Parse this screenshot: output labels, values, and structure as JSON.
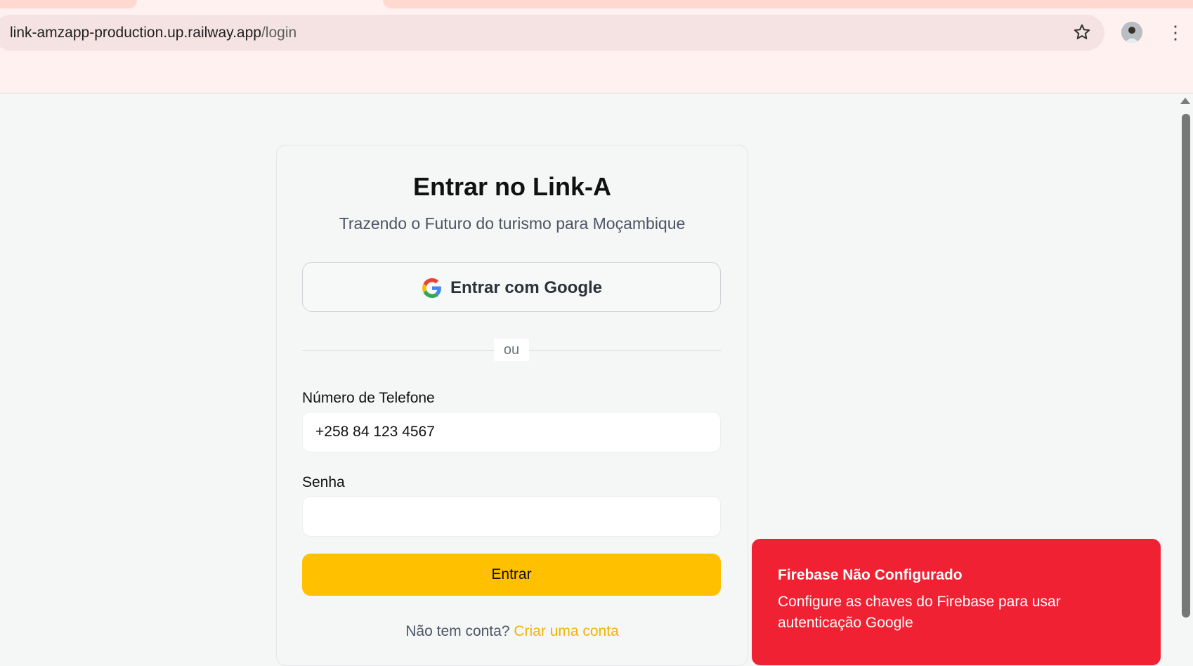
{
  "browser": {
    "url_host": "link-amzapp-production.up.railway.app",
    "url_path": "/login",
    "icons": {
      "bookmark": "star-icon",
      "profile": "avatar",
      "menu": "kebab-icon"
    }
  },
  "login": {
    "title": "Entrar no Link-A",
    "subtitle": "Trazendo o Futuro do turismo para Moçambique",
    "google_button": "Entrar com Google",
    "divider": "ou",
    "phone_label": "Número de Telefone",
    "phone_value": "+258 84 123 4567",
    "password_label": "Senha",
    "password_value": "",
    "submit": "Entrar",
    "no_account": "Não tem conta?",
    "create_account": "Criar uma conta"
  },
  "toast": {
    "title": "Firebase Não Configurado",
    "message": "Configure as chaves do Firebase para usar autenticação Google"
  },
  "colors": {
    "accent": "#ffc000",
    "link": "#f3b400",
    "toast_bg": "#f02133",
    "page_bg": "#f5f6f6"
  }
}
